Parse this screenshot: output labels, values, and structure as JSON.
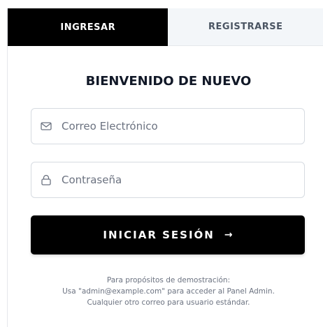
{
  "tabs": {
    "login": "INGRESAR",
    "register": "REGISTRARSE"
  },
  "title": "BIENVENIDO DE NUEVO",
  "email": {
    "icon": "mail-icon",
    "placeholder": "Correo Electrónico",
    "value": ""
  },
  "password": {
    "icon": "lock-icon",
    "placeholder": "Contraseña",
    "value": ""
  },
  "submit": {
    "label": "INICIAR SESIÓN",
    "arrow": "→"
  },
  "demo_note": {
    "line1": "Para propósitos de demostración:",
    "line2": "Usa \"admin@example.com\" para acceder al Panel Admin.",
    "line3": "Cualquier otro correo para usuario estándar."
  },
  "colors": {
    "primary": "#000000",
    "inactive_tab": "#f3f6f9",
    "muted_text": "#6b7280",
    "border": "#d6dbe1"
  }
}
